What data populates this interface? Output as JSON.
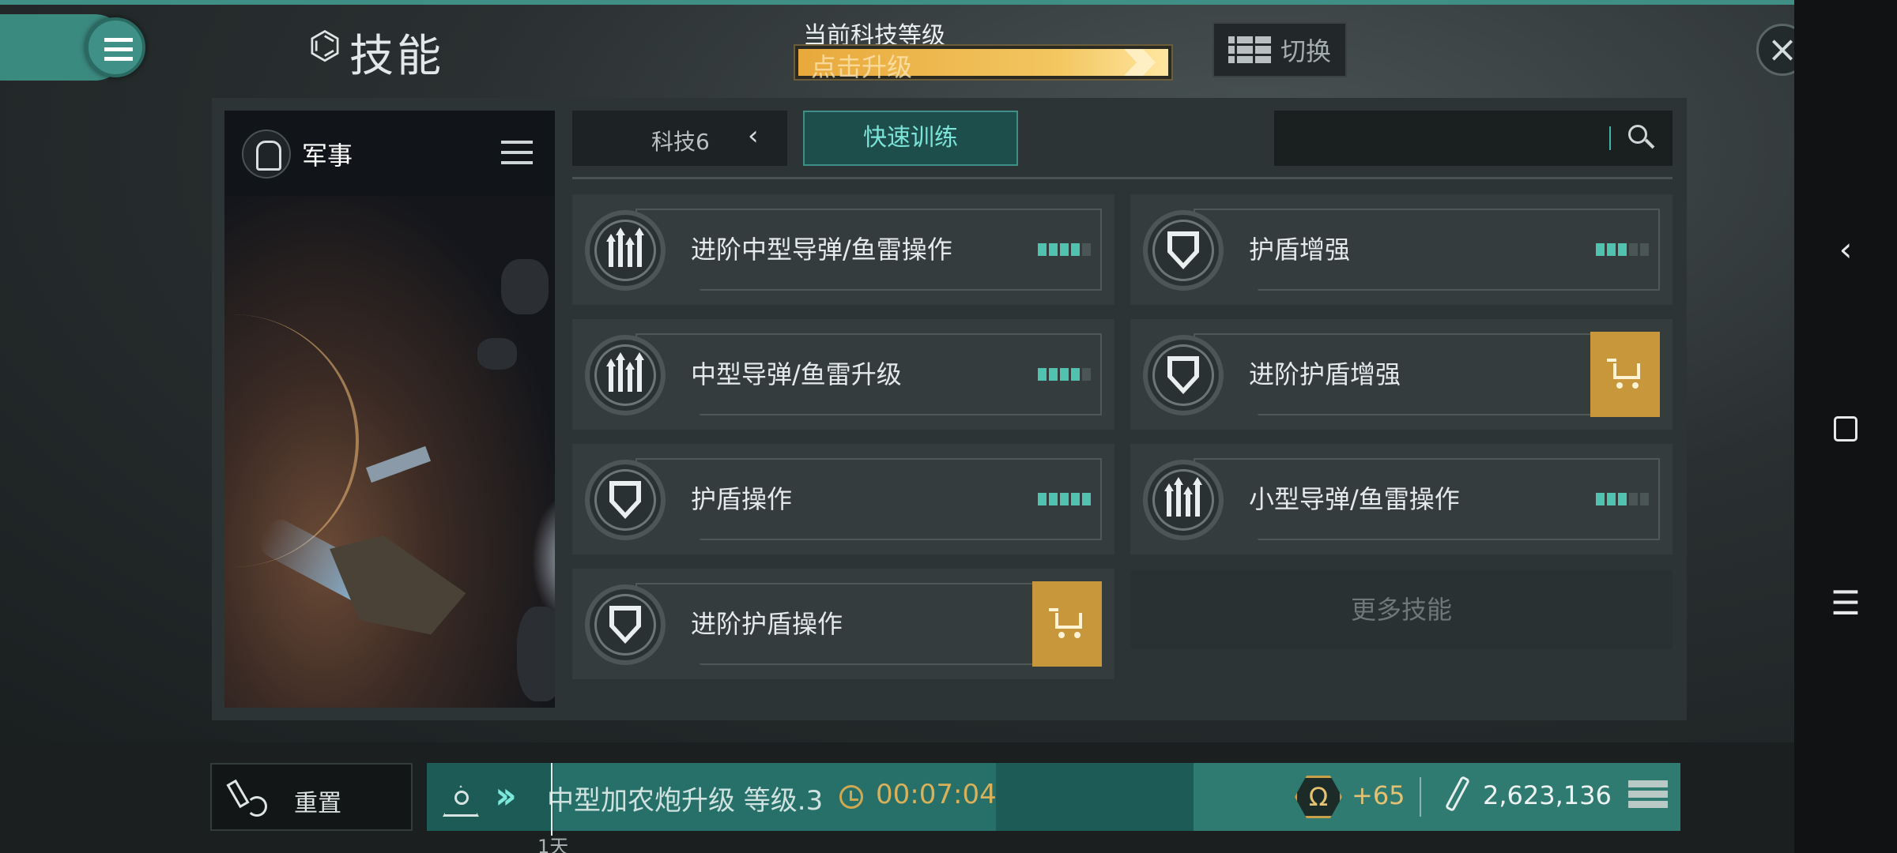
{
  "header": {
    "title": "技能",
    "tech_level_label": "当前科技等级",
    "upgrade_label": "点击升级",
    "switch_label": "切换"
  },
  "category": {
    "name": "军事"
  },
  "tabs": {
    "tech_label": "科技6",
    "quick_train_label": "快速训练"
  },
  "search": {
    "placeholder": ""
  },
  "skills": [
    {
      "name": "进阶中型导弹/鱼雷操作",
      "icon": "missiles-icon",
      "level": 4,
      "max": 5,
      "purchasable": false
    },
    {
      "name": "护盾增强",
      "icon": "shield-icon",
      "level": 3,
      "max": 5,
      "purchasable": false
    },
    {
      "name": "中型导弹/鱼雷升级",
      "icon": "missiles-icon",
      "level": 4,
      "max": 5,
      "purchasable": false
    },
    {
      "name": "进阶护盾增强",
      "icon": "shield-icon",
      "level": null,
      "max": 5,
      "purchasable": true
    },
    {
      "name": "护盾操作",
      "icon": "shield-icon",
      "level": 5,
      "max": 5,
      "purchasable": false
    },
    {
      "name": "小型导弹/鱼雷操作",
      "icon": "missiles-icon",
      "level": 3,
      "max": 5,
      "purchasable": false
    },
    {
      "name": "进阶护盾操作",
      "icon": "shield-icon",
      "level": null,
      "max": 5,
      "purchasable": true
    }
  ],
  "more_skills_label": "更多技能",
  "bottom": {
    "reset_label": "重置",
    "queue_skill": "中型加农炮升级 等级.3",
    "queue_time": "00:07:04",
    "omega_bonus": "+65",
    "resource_value": "2,623,136",
    "day_label": "1天"
  },
  "colors": {
    "accent": "#3f9187",
    "pip_on": "#52c2b0",
    "gold": "#c8973c"
  }
}
